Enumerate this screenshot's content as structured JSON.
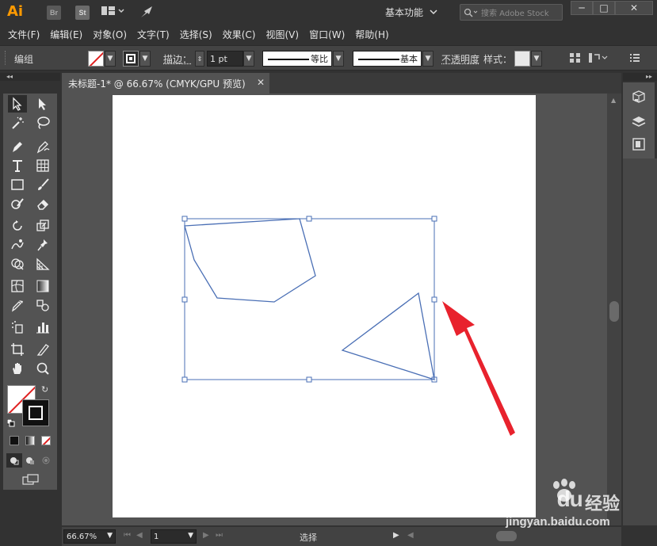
{
  "titlebar": {
    "app_logo": "Ai",
    "badge_br": "Br",
    "badge_st": "St",
    "workspace_label": "基本功能",
    "search_placeholder": "搜索 Adobe Stock",
    "minimize": "─",
    "maximize": "□",
    "close": "✕"
  },
  "menu": {
    "items": [
      "文件(F)",
      "编辑(E)",
      "对象(O)",
      "文字(T)",
      "选择(S)",
      "效果(C)",
      "视图(V)",
      "窗口(W)",
      "帮助(H)"
    ]
  },
  "controlbar": {
    "context_label": "编组",
    "stroke_label": "描边：",
    "stroke_weight": "1 pt",
    "profile_label": "等比",
    "brush_label": "基本",
    "opacity_label": "不透明度",
    "style_label": "样式："
  },
  "document": {
    "tab_title": "未标题-1* @ 66.67% (CMYK/GPU 预览)",
    "close_glyph": "✕"
  },
  "statusbar": {
    "zoom": "66.67%",
    "page": "1",
    "status_text": "选择"
  },
  "watermark": {
    "brand": "Bai",
    "brand2": "du",
    "cn": "经验",
    "url": "jingyan.baidu.com"
  },
  "colors": {
    "accent_orange": "#ff9a00",
    "arrow_red": "#e8222d",
    "shape_blue": "#4a6fb5",
    "panel_gray": "#535353"
  },
  "icons": [
    "selection-tool-icon",
    "direct-selection-icon",
    "magic-wand-icon",
    "lasso-icon",
    "pen-icon",
    "curvature-icon",
    "type-icon",
    "grid-icon",
    "rectangle-icon",
    "paintbrush-icon",
    "shaper-icon",
    "eraser-icon",
    "rotate-icon",
    "scale-icon",
    "warp-icon",
    "pin-icon",
    "shape-builder-icon",
    "perspective-icon",
    "mesh-icon",
    "gradient-icon",
    "eyedropper-icon",
    "blend-icon",
    "symbol-sprayer-icon",
    "bar-graph-icon",
    "artboard-icon",
    "slice-icon",
    "hand-icon",
    "zoom-icon",
    "swap-fill-stroke-icon",
    "default-colors-icon",
    "screen-mode-icon",
    "libraries-icon",
    "layers-icon",
    "artboards-panel-icon",
    "red-arrow-icon"
  ]
}
